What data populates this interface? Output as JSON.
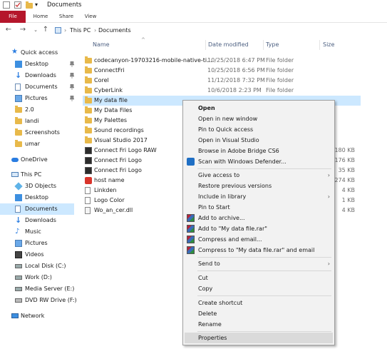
{
  "window": {
    "title": "Documents"
  },
  "ribbon": {
    "tabs": [
      "File",
      "Home",
      "Share",
      "View"
    ]
  },
  "address": {
    "path": [
      "This PC",
      "Documents"
    ]
  },
  "sidebar": {
    "items": [
      {
        "label": "Quick access",
        "icon": "star-icon",
        "pinned": false,
        "selected": false
      },
      {
        "label": "Desktop",
        "icon": "desktop-icon",
        "pinned": true,
        "selected": false
      },
      {
        "label": "Downloads",
        "icon": "download-icon",
        "pinned": true,
        "selected": false
      },
      {
        "label": "Documents",
        "icon": "document-icon",
        "pinned": true,
        "selected": false
      },
      {
        "label": "Pictures",
        "icon": "pictures-icon",
        "pinned": true,
        "selected": false
      },
      {
        "label": "2.0",
        "icon": "folder-icon",
        "pinned": false,
        "selected": false
      },
      {
        "label": "landi",
        "icon": "folder-icon",
        "pinned": false,
        "selected": false
      },
      {
        "label": "Screenshots",
        "icon": "folder-icon",
        "pinned": false,
        "selected": false
      },
      {
        "label": "umar",
        "icon": "folder-icon",
        "pinned": false,
        "selected": false
      },
      {
        "label": "OneDrive",
        "icon": "cloud-icon",
        "pinned": false,
        "selected": false
      },
      {
        "label": "This PC",
        "icon": "computer-icon",
        "pinned": false,
        "selected": false
      },
      {
        "label": "3D Objects",
        "icon": "cube-icon",
        "pinned": false,
        "selected": false
      },
      {
        "label": "Desktop",
        "icon": "desktop-icon",
        "pinned": false,
        "selected": false
      },
      {
        "label": "Documents",
        "icon": "document-icon",
        "pinned": false,
        "selected": true
      },
      {
        "label": "Downloads",
        "icon": "download-icon",
        "pinned": false,
        "selected": false
      },
      {
        "label": "Music",
        "icon": "music-icon",
        "pinned": false,
        "selected": false
      },
      {
        "label": "Pictures",
        "icon": "pictures-icon",
        "pinned": false,
        "selected": false
      },
      {
        "label": "Videos",
        "icon": "video-icon",
        "pinned": false,
        "selected": false
      },
      {
        "label": "Local Disk (C:)",
        "icon": "drive-icon",
        "pinned": false,
        "selected": false
      },
      {
        "label": "Work (D:)",
        "icon": "drive-icon",
        "pinned": false,
        "selected": false
      },
      {
        "label": "Media Server (E:)",
        "icon": "drive-icon",
        "pinned": false,
        "selected": false
      },
      {
        "label": "DVD RW Drive (F:) E",
        "icon": "dvd-icon",
        "pinned": false,
        "selected": false
      },
      {
        "label": "Network",
        "icon": "network-icon",
        "pinned": false,
        "selected": false
      }
    ]
  },
  "columns": [
    "Name",
    "Date modified",
    "Type",
    "Size"
  ],
  "files": [
    {
      "name": "codecanyon-19703216-mobile-native-ti...",
      "date": "10/25/2018 6:47 PM",
      "type": "File folder",
      "size": "",
      "icon": "folder-icon"
    },
    {
      "name": "ConnectFri",
      "date": "10/25/2018 6:56 PM",
      "type": "File folder",
      "size": "",
      "icon": "folder-icon"
    },
    {
      "name": "Corel",
      "date": "11/12/2018 7:32 PM",
      "type": "File folder",
      "size": "",
      "icon": "folder-icon"
    },
    {
      "name": "CyberLink",
      "date": "10/6/2018 2:23 PM",
      "type": "File folder",
      "size": "",
      "icon": "folder-icon"
    },
    {
      "name": "My data file",
      "date": "",
      "type": "",
      "size": "",
      "icon": "folder-icon"
    },
    {
      "name": "My Data Files",
      "date": "",
      "type": "",
      "size": "",
      "icon": "folder-icon"
    },
    {
      "name": "My Palettes",
      "date": "",
      "type": "",
      "size": "",
      "icon": "folder-icon"
    },
    {
      "name": "Sound recordings",
      "date": "",
      "type": "",
      "size": "",
      "icon": "folder-icon"
    },
    {
      "name": "Visual Studio 2017",
      "date": "",
      "type": "",
      "size": "",
      "icon": "folder-icon"
    },
    {
      "name": "Connect Fri Logo RAW",
      "date": "",
      "type": "",
      "size": "180 KB",
      "icon": "image-file-icon"
    },
    {
      "name": "Connect Fri Logo",
      "date": "",
      "type": "",
      "size": "176 KB",
      "icon": "image-file-icon"
    },
    {
      "name": "Connect Fri Logo",
      "date": "",
      "type": "",
      "size": "35 KB",
      "icon": "image-file-icon"
    },
    {
      "name": "host name",
      "date": "",
      "type": "",
      "size": "274 KB",
      "icon": "red-file-icon"
    },
    {
      "name": "Linkden",
      "date": "",
      "type": "",
      "size": "4 KB",
      "icon": "text-file-icon"
    },
    {
      "name": "Logo Color",
      "date": "",
      "type": "",
      "size": "1 KB",
      "icon": "text-file-icon"
    },
    {
      "name": "Wo_an_cer.dll",
      "date": "",
      "type": "",
      "size": "4 KB",
      "icon": "dll-file-icon"
    }
  ],
  "context_menu": {
    "groups": [
      [
        {
          "label": "Open",
          "bold": true
        },
        {
          "label": "Open in new window"
        },
        {
          "label": "Pin to Quick access"
        },
        {
          "label": "Open in Visual Studio"
        },
        {
          "label": "Browse in Adobe Bridge CS6"
        },
        {
          "label": "Scan with Windows Defender...",
          "icon": "defender-icon"
        }
      ],
      [
        {
          "label": "Give access to",
          "submenu": true
        },
        {
          "label": "Restore previous versions"
        },
        {
          "label": "Include in library",
          "submenu": true
        },
        {
          "label": "Pin to Start"
        },
        {
          "label": "Add to archive...",
          "icon": "winrar-icon"
        },
        {
          "label": "Add to \"My data file.rar\"",
          "icon": "winrar-icon"
        },
        {
          "label": "Compress and email...",
          "icon": "winrar-icon"
        },
        {
          "label": "Compress to \"My data file.rar\" and email",
          "icon": "winrar-icon"
        }
      ],
      [
        {
          "label": "Send to",
          "submenu": true
        }
      ],
      [
        {
          "label": "Cut"
        },
        {
          "label": "Copy"
        }
      ],
      [
        {
          "label": "Create shortcut"
        },
        {
          "label": "Delete"
        },
        {
          "label": "Rename"
        }
      ],
      [
        {
          "label": "Properties",
          "highlighted": true
        }
      ]
    ]
  }
}
